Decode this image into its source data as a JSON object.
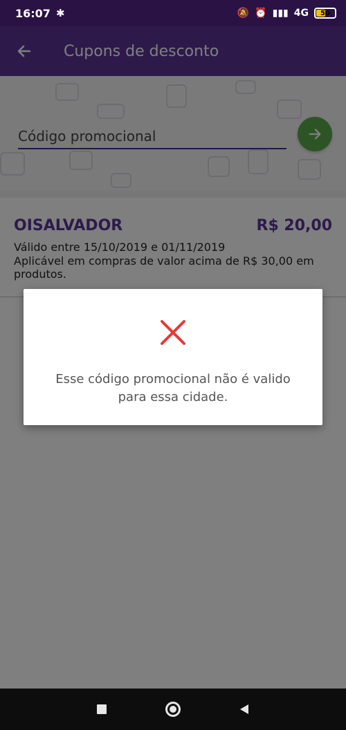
{
  "status_bar": {
    "time": "16:07",
    "network": "4G",
    "battery": "50",
    "battery_level": 0.5
  },
  "app_bar": {
    "title": "Cupons de desconto",
    "back_icon": "arrow-left-icon"
  },
  "promo": {
    "input_placeholder": "Código promocional",
    "input_value": "",
    "submit_icon": "arrow-right-icon"
  },
  "coupon": {
    "code": "OISALVADOR",
    "value": "R$ 20,00",
    "validity": "Válido entre 15/10/2019 e 01/11/2019",
    "condition": "Aplicável em compras de valor acima de R$ 30,00 em produtos."
  },
  "dialog": {
    "icon": "close-x-icon",
    "message_line1": "Esse código promocional não é valido",
    "message_line2": "para essa cidade."
  },
  "nav_bar": {
    "recent_icon": "square-icon",
    "home_icon": "circle-icon",
    "back_icon": "triangle-left-icon"
  },
  "colors": {
    "status_bar": "#2a1245",
    "app_bar": "#5b3597",
    "accent_purple": "#5b3597",
    "submit_green": "#5aa84a",
    "error_red": "#e53935"
  }
}
